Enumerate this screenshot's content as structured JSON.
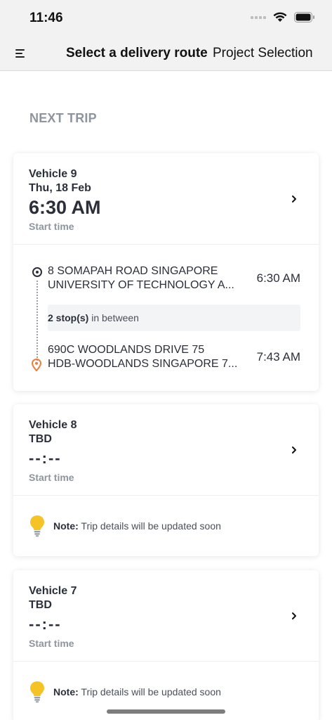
{
  "status_bar": {
    "time": "11:46"
  },
  "nav": {
    "title": "Select a delivery route",
    "action": "Project Selection"
  },
  "section": {
    "header": "NEXT TRIP"
  },
  "trips": [
    {
      "vehicle": "Vehicle 9",
      "date": "Thu, 18 Feb",
      "time": "6:30 AM",
      "start_label": "Start time",
      "origin": {
        "line1": "8 SOMAPAH ROAD SINGAPORE",
        "line2": "UNIVERSITY OF TECHNOLOGY A...",
        "time": "6:30 AM"
      },
      "between": {
        "count": "2 stop(s)",
        "suffix": " in between"
      },
      "destination": {
        "line1": "690C WOODLANDS DRIVE 75",
        "line2": "HDB-WOODLANDS SINGAPORE 7...",
        "time": "7:43 AM"
      }
    },
    {
      "vehicle": "Vehicle 8",
      "date": "TBD",
      "time": "--:--",
      "start_label": "Start time",
      "note_label": "Note:",
      "note_text": " Trip details will be updated soon"
    },
    {
      "vehicle": "Vehicle 7",
      "date": "TBD",
      "time": "--:--",
      "start_label": "Start time",
      "note_label": "Note:",
      "note_text": " Trip details will be updated soon"
    }
  ],
  "colors": {
    "accent_text": "#2b2f3a",
    "muted_text": "#8e959f",
    "destination_pin": "#f07d3a",
    "bulb": "#f6c327"
  },
  "icons": [
    "menu-icon",
    "wifi-icon",
    "battery-icon",
    "chevron-right-icon",
    "origin-marker-icon",
    "destination-pin-icon",
    "lightbulb-icon"
  ]
}
